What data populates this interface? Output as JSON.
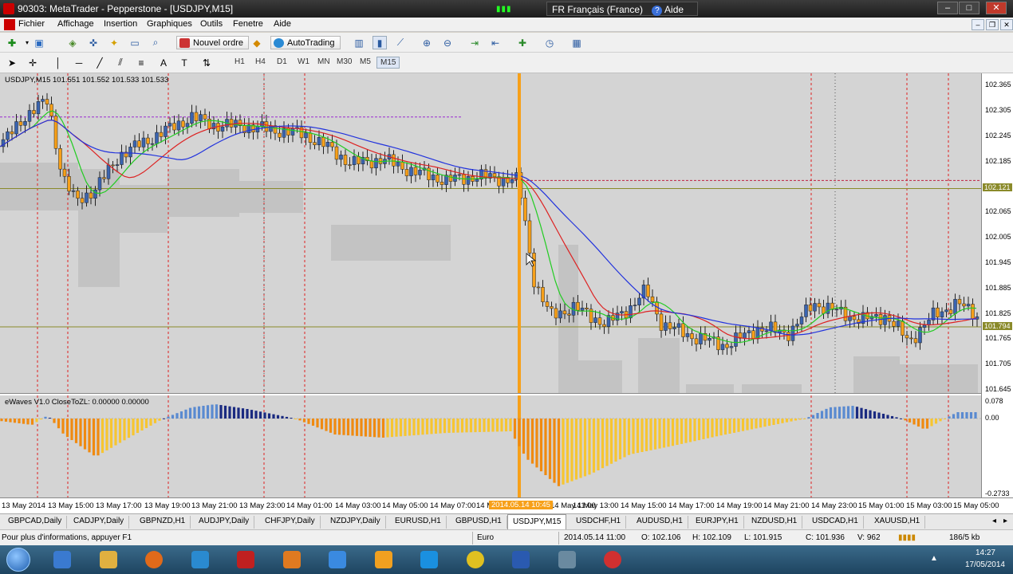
{
  "window": {
    "title": "90303: MetaTrader - Pepperstone - [USDJPY,M15]",
    "language": "FR Français (France)",
    "help": "Aide",
    "controls": [
      "–",
      "□",
      "✕"
    ]
  },
  "menu": [
    "Fichier",
    "Affichage",
    "Insertion",
    "Graphiques",
    "Outils",
    "Fenetre",
    "Aide"
  ],
  "toolbar": {
    "new_order": "Nouvel ordre",
    "autotrading": "AutoTrading",
    "search_placeholder": ""
  },
  "timeframes": [
    "H1",
    "H4",
    "D1",
    "W1",
    "MN",
    "M30",
    "M5",
    "M15"
  ],
  "selected_timeframe": "M15",
  "chart": {
    "symbol_info": "USDJPY,M15  101.551 101.552 101.533 101.533",
    "indicator_info": "eWaves V1.0 CloseToZL: 0.00000 0.00000",
    "price_labels": [
      "102.365",
      "102.305",
      "102.245",
      "102.185",
      "102.121",
      "102.065",
      "102.005",
      "101.945",
      "101.885",
      "101.825",
      "101.794",
      "101.765",
      "101.705",
      "101.645"
    ],
    "highlight_prices": [
      "102.121",
      "101.794"
    ],
    "indicator_labels": [
      "0.078",
      "0.00",
      "-0.2733"
    ],
    "time_labels": [
      "13 May 2014",
      "13 May 15:00",
      "13 May 17:00",
      "13 May 19:00",
      "13 May 21:00",
      "13 May 23:00",
      "14 May 01:00",
      "14 May 03:00",
      "14 May 05:00",
      "14 May 07:00",
      "14 May",
      "14 May 11:00",
      "14 May 13:00",
      "14 May 15:00",
      "14 May 17:00",
      "14 May 19:00",
      "14 May 21:00",
      "14 May 23:00",
      "15 May 01:00",
      "15 May 03:00",
      "15 May 05:00"
    ],
    "time_cursor": "2014.05.14 10:45",
    "colors": {
      "background": "#d4d4d4",
      "bull": "#3a64b0",
      "bear": "#f7a019",
      "ma_fast": "#22cc22",
      "ma_mid": "#dd2222",
      "ma_slow": "#2233dd",
      "cursor": "#f7a019",
      "hist_pos_light": "#5a8ad0",
      "hist_pos_dark": "#1a2a80",
      "hist_neg_light": "#f7c530",
      "hist_neg_dark": "#f08a10"
    }
  },
  "tabs": [
    "GBPCAD,Daily",
    "CADJPY,Daily",
    "GBPNZD,H1",
    "AUDJPY,Daily",
    "CHFJPY,Daily",
    "NZDJPY,Daily",
    "EURUSD,H1",
    "GBPUSD,H1",
    "USDJPY,M15",
    "USDCHF,H1",
    "AUDUSD,H1",
    "EURJPY,H1",
    "NZDUSD,H1",
    "USDCAD,H1",
    "XAUUSD,H1"
  ],
  "active_tab": "USDJPY,M15",
  "status": {
    "help": "Pour plus d'informations, appuyer F1",
    "profile": "Euro",
    "time": "2014.05.14 11:00",
    "open": "O: 102.106",
    "high": "H: 102.109",
    "low": "L: 101.915",
    "close": "C: 101.936",
    "volume": "V: 962",
    "traffic": "186/5 kb"
  },
  "taskbar": {
    "time": "14:27",
    "date": "17/05/2014",
    "apps": [
      "explorer-icon",
      "files-icon",
      "firefox-icon",
      "app-icon",
      "metatrader-icon",
      "outlook-icon",
      "ie-icon",
      "media-icon",
      "skype-icon",
      "chrome-icon",
      "word-icon",
      "app2-icon",
      "chrome2-icon"
    ]
  }
}
